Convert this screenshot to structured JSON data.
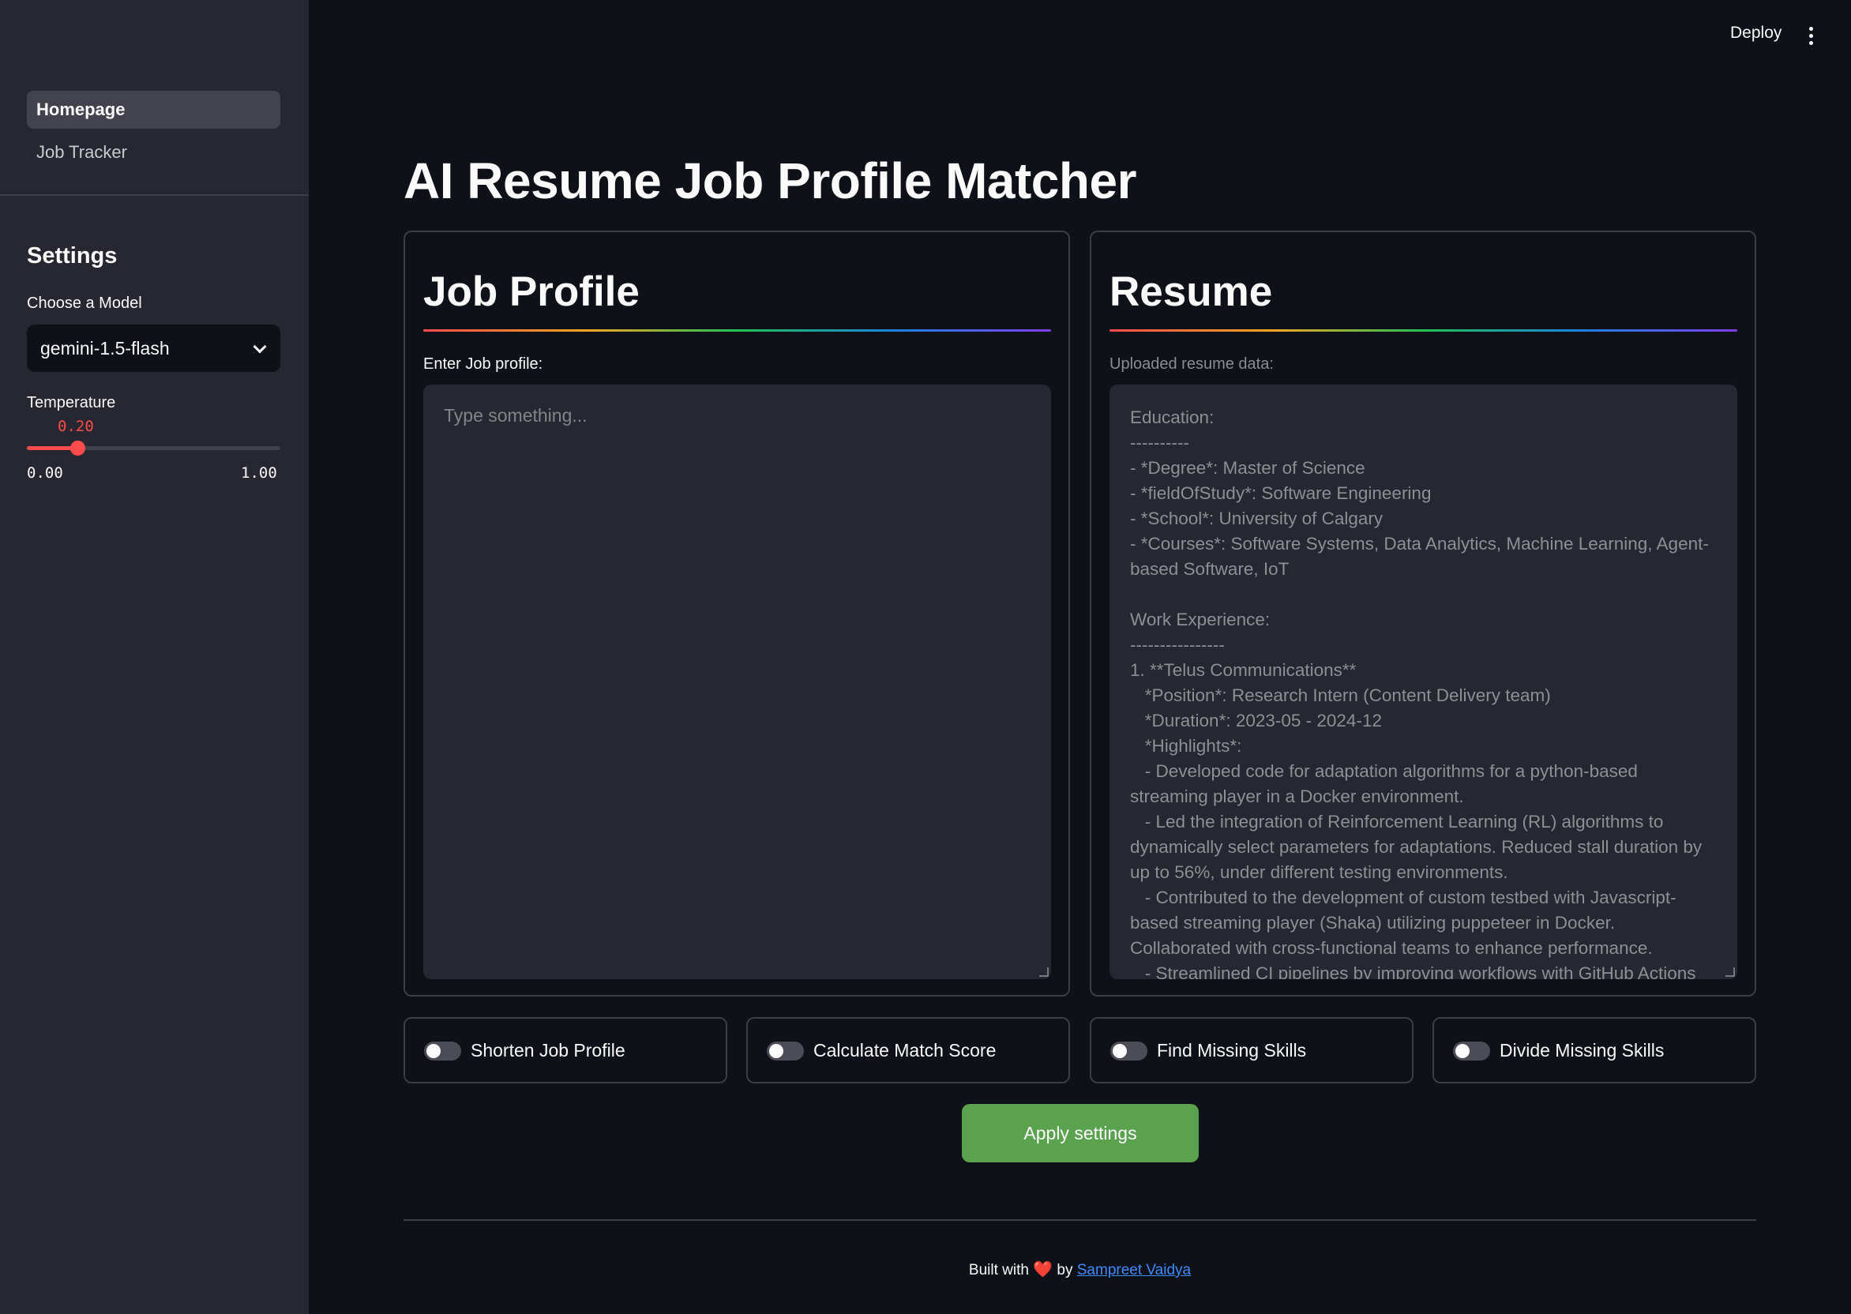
{
  "header": {
    "deploy_label": "Deploy",
    "menu_icon": "kebab-menu-icon"
  },
  "sidebar": {
    "nav": [
      {
        "label": "Homepage",
        "active": true
      },
      {
        "label": "Job Tracker",
        "active": false
      }
    ],
    "settings_title": "Settings",
    "model": {
      "label": "Choose a Model",
      "value": "gemini-1.5-flash",
      "icon": "chevron-down-icon"
    },
    "temperature": {
      "label": "Temperature",
      "value": "0.20",
      "min": "0.00",
      "max": "1.00",
      "fraction": 0.2,
      "accent": "#ff4b4b"
    }
  },
  "main": {
    "title": "AI Resume Job Profile Matcher",
    "job_profile": {
      "heading": "Job Profile",
      "field_label": "Enter Job profile:",
      "placeholder": "Type something..."
    },
    "resume": {
      "heading": "Resume",
      "field_label": "Uploaded resume data:",
      "text": "Education:\n----------\n- *Degree*: Master of Science\n- *fieldOfStudy*: Software Engineering\n- *School*: University of Calgary\n- *Courses*: Software Systems, Data Analytics, Machine Learning, Agent-based Software, IoT\n\nWork Experience:\n----------------\n1. **Telus Communications**\n   *Position*: Research Intern (Content Delivery team)\n   *Duration*: 2023-05 - 2024-12\n   *Highlights*:\n   - Developed code for adaptation algorithms for a python-based streaming player in a Docker environment.\n   - Led the integration of Reinforcement Learning (RL) algorithms to dynamically select parameters for adaptations. Reduced stall duration by up to 56%, under different testing environments.\n   - Contributed to the development of custom testbed with Javascript-based streaming player (Shaka) utilizing puppeteer in Docker. Collaborated with cross-functional teams to enhance performance.\n   - Streamlined CI pipelines by improving workflows with GitHub Actions"
    },
    "toggles": [
      {
        "label": "Shorten Job Profile",
        "on": false
      },
      {
        "label": "Calculate Match Score",
        "on": false
      },
      {
        "label": "Find Missing Skills",
        "on": false
      },
      {
        "label": "Divide Missing Skills",
        "on": false
      }
    ],
    "apply_label": "Apply settings",
    "accent_green": "#5ba24f"
  },
  "footer": {
    "prefix": "Built with",
    "heart": "❤️",
    "by": "by",
    "author": "Sampreet Vaidya"
  }
}
